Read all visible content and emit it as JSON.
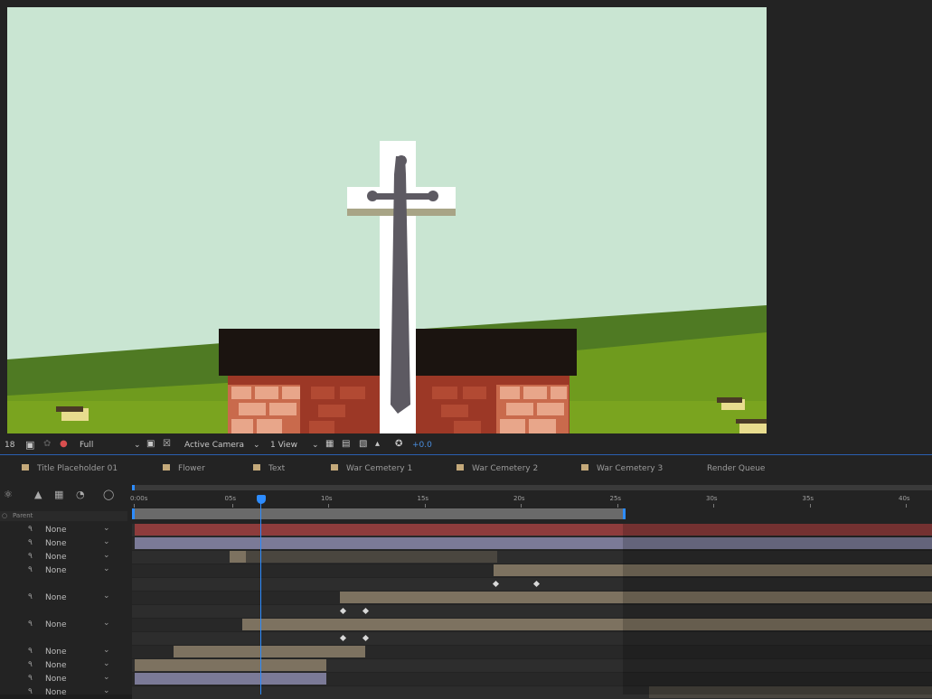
{
  "viewer": {
    "resolution_fragment": "18",
    "resolution": "Full",
    "camera": "Active Camera",
    "view_layout": "1 View",
    "exposure": "+0.0"
  },
  "tabs": [
    {
      "label": "Title Placeholder 01",
      "swatch": "#c4a97a"
    },
    {
      "label": "Flower",
      "swatch": "#c4a97a"
    },
    {
      "label": "Text",
      "swatch": "#c4a97a"
    },
    {
      "label": "War Cemetery 1",
      "swatch": "#c4a97a"
    },
    {
      "label": "War Cemetery 2",
      "swatch": "#c4a97a"
    },
    {
      "label": "War Cemetery 3",
      "swatch": "#c4a97a"
    },
    {
      "label": "Render Queue",
      "swatch": ""
    }
  ],
  "timeline": {
    "column_header": "Parent",
    "ruler_ticks": [
      "0:00s",
      "05s",
      "10s",
      "15s",
      "20s",
      "25s",
      "30s",
      "35s",
      "40s"
    ],
    "parent_rows": [
      {
        "value": "None"
      },
      {
        "value": "None"
      },
      {
        "value": "None"
      },
      {
        "value": "None"
      },
      {
        "value": ""
      },
      {
        "value": "None"
      },
      {
        "value": ""
      },
      {
        "value": "None"
      },
      {
        "value": ""
      },
      {
        "value": "None"
      },
      {
        "value": "None"
      },
      {
        "value": "None"
      },
      {
        "value": "None"
      }
    ]
  },
  "colors": {
    "accent": "#2d8cff",
    "bar_red": "#8e3c3c",
    "bar_lavender": "#7b7a97",
    "bar_tan": "#7d7260",
    "sky": "#c9e5d2",
    "grass": "#6f9b1e"
  },
  "icons": [
    "camera-snapshot-icon",
    "color-channel-icon",
    "region-of-interest-icon",
    "transparency-grid-icon",
    "3d-view-icon",
    "fast-preview-icon",
    "timeline-icon",
    "reset-exposure-icon",
    "search-layers-icon",
    "shy-layers-icon",
    "frame-blending-icon",
    "motion-blur-icon",
    "graph-editor-icon"
  ]
}
